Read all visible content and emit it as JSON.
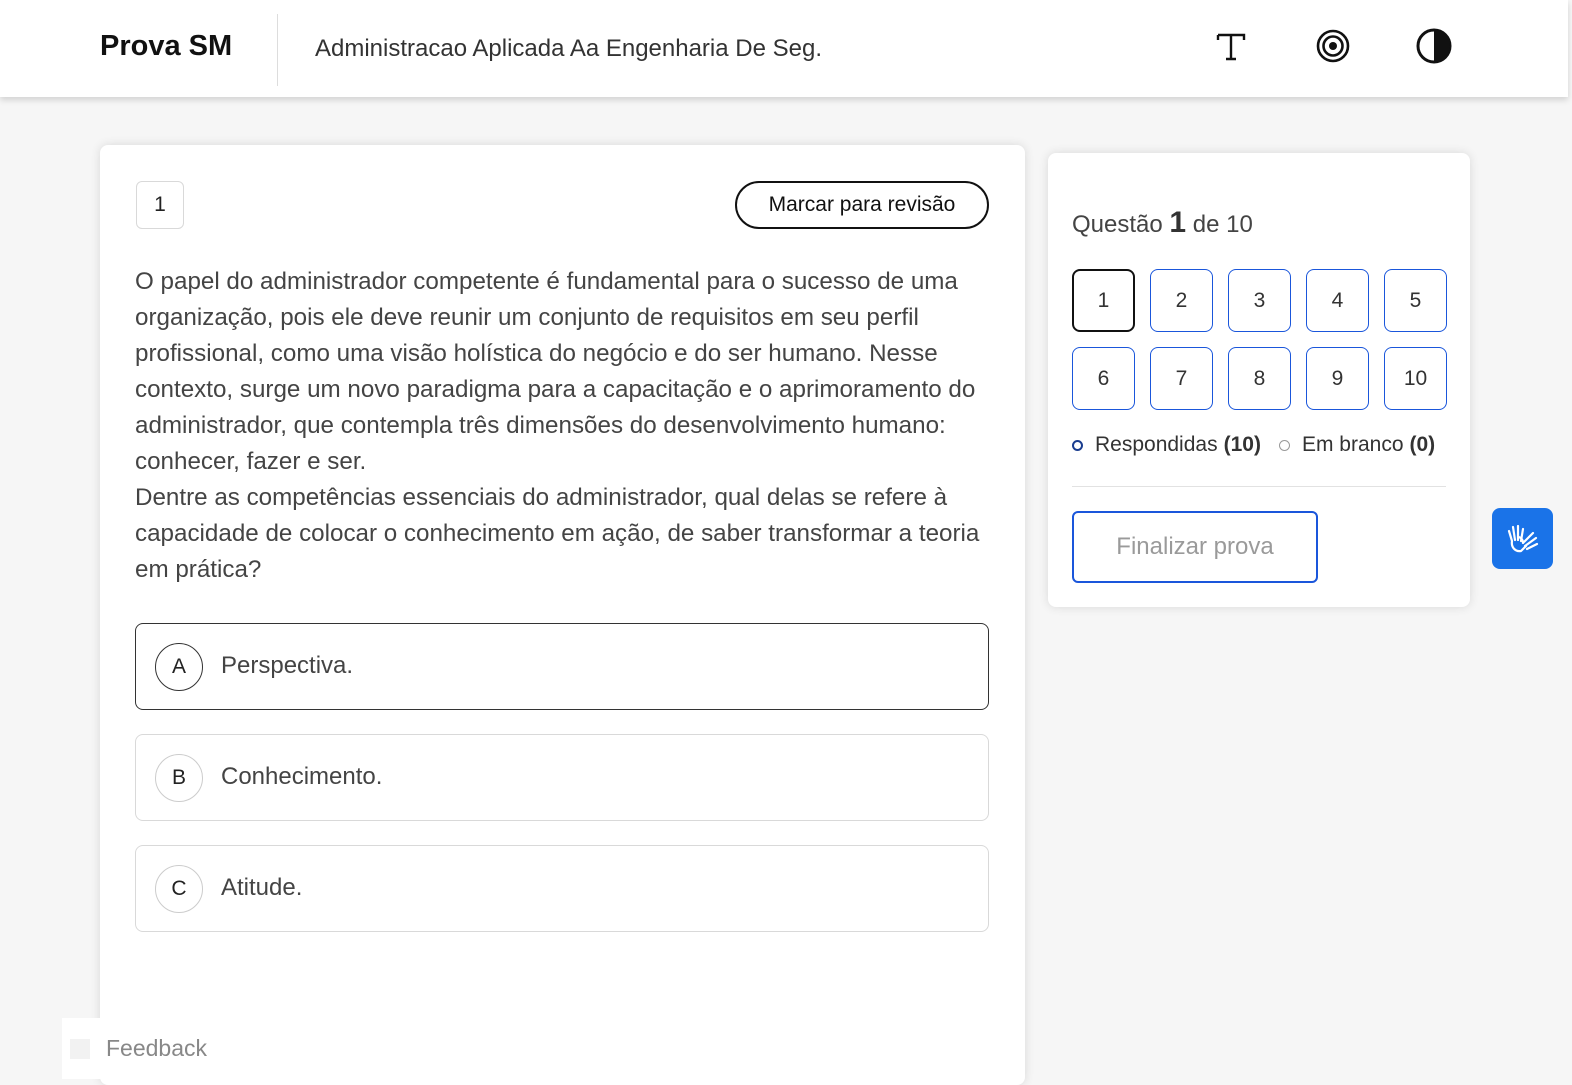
{
  "header": {
    "brand": "Prova SM",
    "course_title": "Administracao Aplicada Aa Engenharia De Seg.",
    "icons": [
      "font-size-icon",
      "target-icon",
      "contrast-icon"
    ]
  },
  "question": {
    "number": "1",
    "review_label": "Marcar para revisão",
    "paragraphs": [
      "O papel do administrador competente é fundamental para o sucesso de uma organização, pois ele deve reunir um conjunto de requisitos em seu perfil profissional, como uma visão holística do negócio e do ser humano. Nesse contexto, surge um novo paradigma para a capacitação e o aprimoramento do administrador, que contempla três dimensões do desenvolvimento humano: conhecer, fazer e ser.",
      "Dentre as competências essenciais do administrador, qual delas se refere à capacidade de colocar o conhecimento em ação, de saber transformar a teoria em prática?"
    ],
    "options": [
      {
        "letter": "A",
        "text": "Perspectiva.",
        "selected": true
      },
      {
        "letter": "B",
        "text": "Conhecimento.",
        "selected": false
      },
      {
        "letter": "C",
        "text": "Atitude.",
        "selected": false
      }
    ]
  },
  "nav": {
    "title_prefix": "Questão",
    "current": "1",
    "title_suffix": "de 10",
    "buttons": [
      "1",
      "2",
      "3",
      "4",
      "5",
      "6",
      "7",
      "8",
      "9",
      "10"
    ],
    "answered_label": "Respondidas",
    "answered_count": "(10)",
    "blank_label": "Em branco",
    "blank_count": "(0)",
    "finish_label": "Finalizar prova"
  },
  "accessibility": {
    "icon": "sign-language-icon",
    "color": "#1a73e8"
  },
  "feedback": {
    "label": "Feedback"
  },
  "colors": {
    "accent": "#1a56db",
    "text": "#444444"
  }
}
